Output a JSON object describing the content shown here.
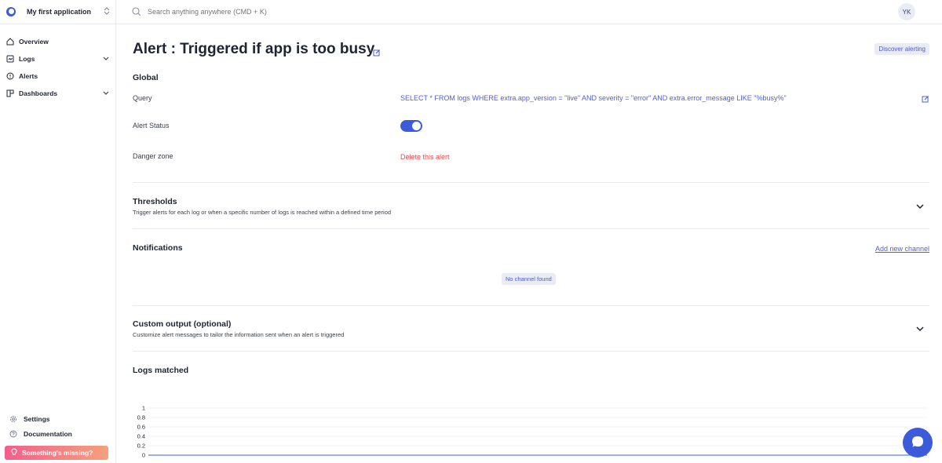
{
  "app": {
    "name": "My first application"
  },
  "sidebar": {
    "items": [
      {
        "label": "Overview",
        "icon": "home-icon",
        "expandable": false
      },
      {
        "label": "Logs",
        "icon": "logs-icon",
        "expandable": true
      },
      {
        "label": "Alerts",
        "icon": "alert-icon",
        "expandable": false
      },
      {
        "label": "Dashboards",
        "icon": "dashboard-icon",
        "expandable": true
      }
    ],
    "bottom": [
      {
        "label": "Settings",
        "icon": "gear-icon"
      },
      {
        "label": "Documentation",
        "icon": "help-icon"
      }
    ],
    "missing_label": "Something's missing?"
  },
  "search": {
    "placeholder": "Search anything anywhere (CMD + K)"
  },
  "user": {
    "initials": "YK"
  },
  "page": {
    "title": "Alert : Triggered if app is too busy",
    "discover_label": "Discover alerting"
  },
  "global": {
    "title": "Global",
    "query_label": "Query",
    "query_value": "SELECT * FROM logs WHERE extra.app_version = \"live\" AND severity = \"error\" AND extra.error_message LIKE \"%busy%\"",
    "status_label": "Alert Status",
    "status_enabled": true,
    "danger_label": "Danger zone",
    "delete_label": "Delete this alert"
  },
  "thresholds": {
    "title": "Thresholds",
    "subtitle": "Trigger alerts for each log or when a specific number of logs is reached within a defined time period"
  },
  "notifications": {
    "title": "Notifications",
    "add_label": "Add new channel",
    "empty_label": "No channel found"
  },
  "custom_output": {
    "title": "Custom output (optional)",
    "subtitle": "Customize alert messages to tailor the information sent when an alert is triggered"
  },
  "logs_matched": {
    "title": "Logs matched"
  },
  "colors": {
    "accent": "#3b5bdb",
    "danger": "#e5484d",
    "link": "#4f5fd1"
  },
  "chart_data": {
    "type": "line",
    "yticks": [
      "1",
      "0.8",
      "0.6",
      "0.4",
      "0.2",
      "0"
    ],
    "ylim": [
      0,
      1
    ],
    "series": [
      {
        "values": [
          0,
          0,
          0,
          0,
          0,
          0
        ]
      }
    ]
  }
}
